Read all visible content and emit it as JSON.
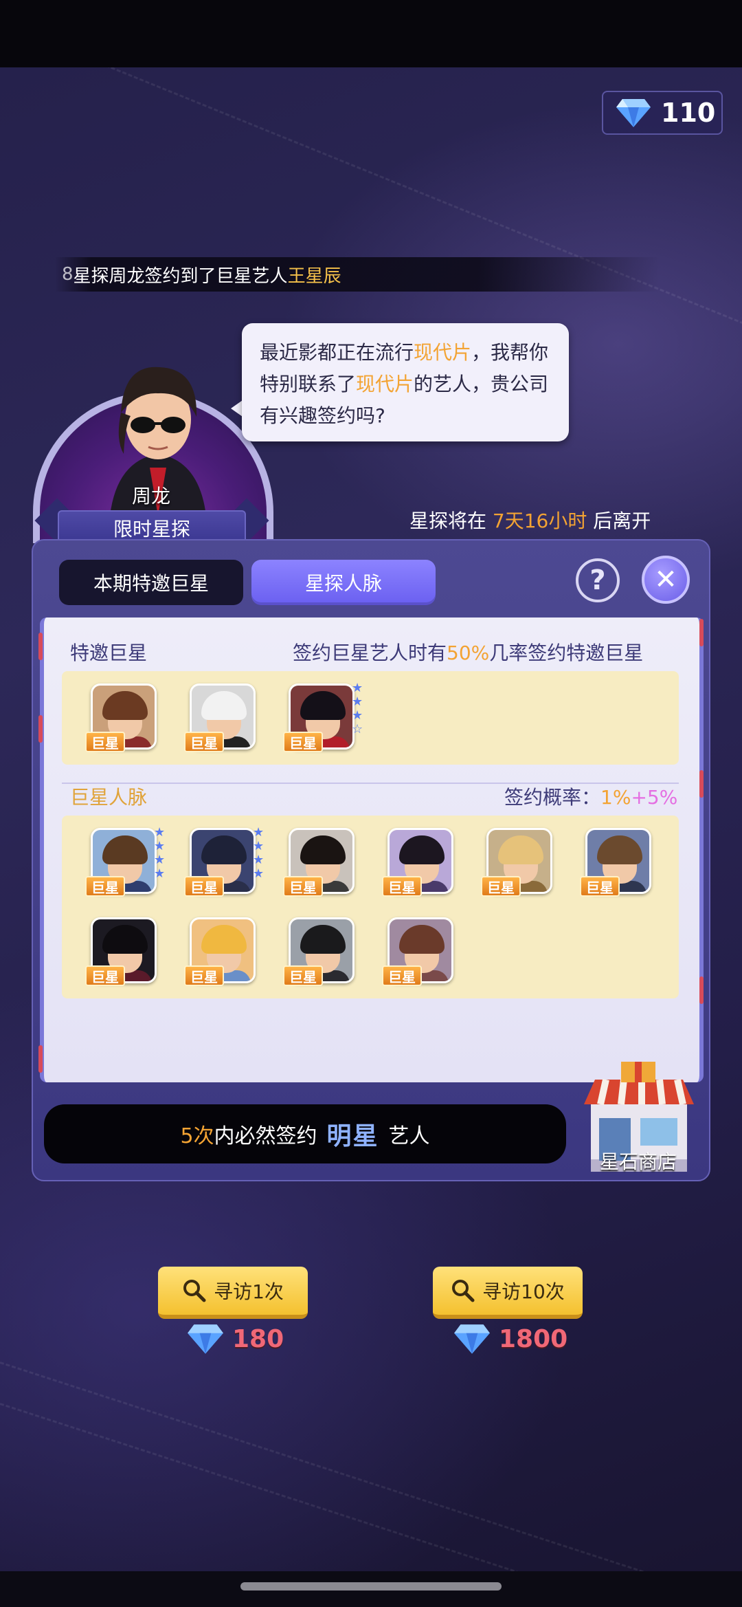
{
  "currency": {
    "icon": "diamond-icon",
    "value": "110"
  },
  "ticker": {
    "prefix_glyph": "8",
    "text_before": "星探周龙签约到了巨星艺人",
    "highlight": "王星辰"
  },
  "scout": {
    "name": "周龙",
    "ribbon": "限时星探",
    "bubble": {
      "p1": "最近影都正在流行",
      "k1": "现代片",
      "p2": "，我帮你特别联系了",
      "k2": "现代片",
      "p3": "的艺人，贵公司有兴趣签约吗?"
    },
    "timer": {
      "before": "星探将在 ",
      "value": "7天16小时",
      "after": " 后离开"
    }
  },
  "tabs": [
    {
      "label": "本期特邀巨星",
      "active": false
    },
    {
      "label": "星探人脉",
      "active": true
    }
  ],
  "buttons": {
    "help": "?",
    "close": "✕"
  },
  "special": {
    "title": "特邀巨星",
    "note_before": "签约巨星艺人时有",
    "note_pct": "50%",
    "note_after": "几率签约特邀巨星",
    "cards": [
      {
        "badge": "巨星",
        "stars": 0
      },
      {
        "badge": "巨星",
        "stars": 0
      },
      {
        "badge": "巨星",
        "stars": 4
      }
    ]
  },
  "network": {
    "title": "巨星人脉",
    "rate_label": "签约概率：",
    "rate_base": "1%",
    "rate_bonus": "+5%",
    "cards": [
      {
        "badge": "巨星",
        "stars": 4
      },
      {
        "badge": "巨星",
        "stars": 4
      },
      {
        "badge": "巨星",
        "stars": 0
      },
      {
        "badge": "巨星",
        "stars": 0
      },
      {
        "badge": "巨星",
        "stars": 0
      },
      {
        "badge": "巨星",
        "stars": 0
      },
      {
        "badge": "巨星",
        "stars": 0
      },
      {
        "badge": "巨星",
        "stars": 0
      },
      {
        "badge": "巨星",
        "stars": 0
      },
      {
        "badge": "巨星",
        "stars": 0
      }
    ]
  },
  "guarantee": {
    "count": "5次",
    "middle": "内必然签约",
    "big": "明星",
    "after": "艺人"
  },
  "shop": {
    "label": "星石商店"
  },
  "actions": [
    {
      "label": "寻访1次",
      "cost": "180"
    },
    {
      "label": "寻访10次",
      "cost": "1800"
    }
  ],
  "colors": {
    "accent_gold": "#f5c14a",
    "accent_orange": "#f3a333",
    "accent_pink": "#e46fe2",
    "panel": "#4d4992",
    "tab_active": "#7a70f8"
  }
}
